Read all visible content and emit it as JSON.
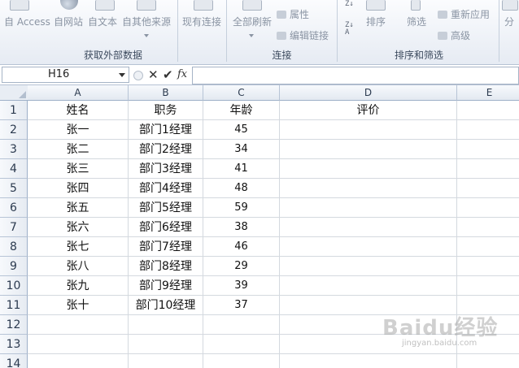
{
  "ribbon": {
    "group_labels": {
      "external_data": "获取外部数据",
      "connections": "连接",
      "sort_filter": "排序和筛选"
    },
    "buttons": {
      "access": "自 Access",
      "web": "自网站",
      "text": "自文本",
      "other_sources": "自其他来源",
      "existing_connections": "现有连接",
      "refresh_all": "全部刷新",
      "properties": "属性",
      "edit_links": "编辑链接",
      "sort": "排序",
      "filter": "筛选",
      "reapply": "重新应用",
      "advanced": "高级",
      "split": "分"
    }
  },
  "formula_bar": {
    "name_box": "H16",
    "cancel_symbol": "✕",
    "enter_symbol": "✔",
    "fx_symbol": "fx",
    "formula": ""
  },
  "sheet": {
    "columns": [
      "A",
      "B",
      "C",
      "D",
      "E"
    ],
    "rows": [
      {
        "num": "1",
        "cells": [
          "姓名",
          "职务",
          "年龄",
          "评价",
          ""
        ]
      },
      {
        "num": "2",
        "cells": [
          "张一",
          "部门1经理",
          "45",
          "",
          ""
        ]
      },
      {
        "num": "3",
        "cells": [
          "张二",
          "部门2经理",
          "34",
          "",
          ""
        ]
      },
      {
        "num": "4",
        "cells": [
          "张三",
          "部门3经理",
          "41",
          "",
          ""
        ]
      },
      {
        "num": "5",
        "cells": [
          "张四",
          "部门4经理",
          "48",
          "",
          ""
        ]
      },
      {
        "num": "6",
        "cells": [
          "张五",
          "部门5经理",
          "59",
          "",
          ""
        ]
      },
      {
        "num": "7",
        "cells": [
          "张六",
          "部门6经理",
          "38",
          "",
          ""
        ]
      },
      {
        "num": "8",
        "cells": [
          "张七",
          "部门7经理",
          "46",
          "",
          ""
        ]
      },
      {
        "num": "9",
        "cells": [
          "张八",
          "部门8经理",
          "29",
          "",
          ""
        ]
      },
      {
        "num": "10",
        "cells": [
          "张九",
          "部门9经理",
          "39",
          "",
          ""
        ]
      },
      {
        "num": "11",
        "cells": [
          "张十",
          "部门10经理",
          "37",
          "",
          ""
        ]
      },
      {
        "num": "12",
        "cells": [
          "",
          "",
          "",
          "",
          ""
        ]
      },
      {
        "num": "13",
        "cells": [
          "",
          "",
          "",
          "",
          ""
        ]
      },
      {
        "num": "14",
        "cells": [
          "",
          "",
          "",
          "",
          ""
        ]
      }
    ]
  },
  "watermark": {
    "text": "Baidu经验",
    "sub": "jingyan.baidu.com"
  }
}
